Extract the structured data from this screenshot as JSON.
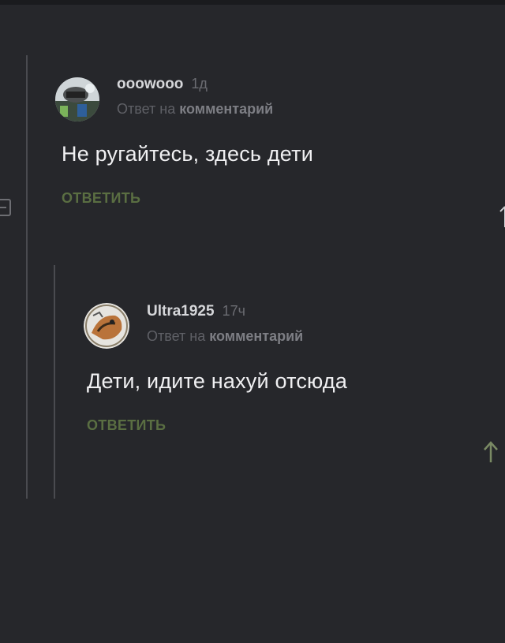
{
  "thread": {
    "comments": [
      {
        "username": "ooowooo",
        "time": "1д",
        "reply_prefix": "Ответ на",
        "reply_target": "комментарий",
        "text": "Не ругайтесь, здесь дети",
        "reply_label": "ОТВЕТИТЬ"
      },
      {
        "username": "Ultra1925",
        "time": "17ч",
        "reply_prefix": "Ответ на",
        "reply_target": "комментарий",
        "text": "Дети, идите нахуй отсюда",
        "reply_label": "ОТВЕТИТЬ"
      }
    ]
  },
  "icons": {
    "scroll_up": "up-arrow-icon",
    "collapse": "collapse-thread-icon"
  },
  "colors": {
    "background": "#26272b",
    "accent_green": "#5a6e42",
    "muted_text": "#5f6066"
  }
}
